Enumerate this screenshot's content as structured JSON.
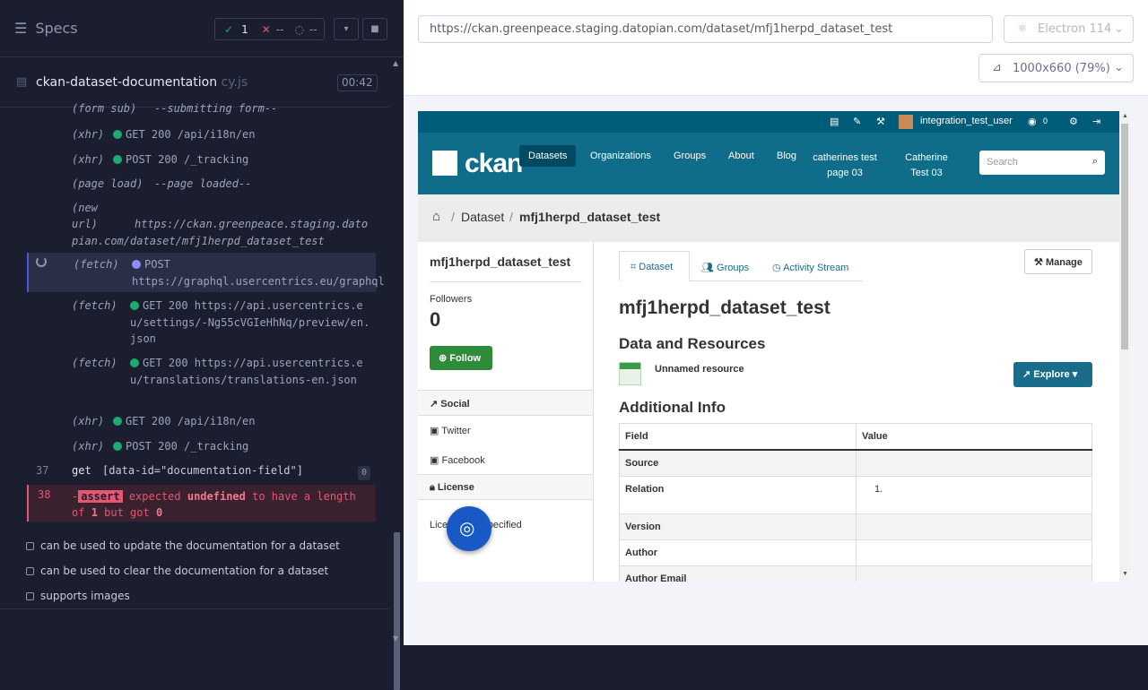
{
  "runner": {
    "specs_title": "Specs",
    "passed_count": "1",
    "failed_count": "--",
    "pending_count": "--",
    "file_name": "ckan-dataset-documentation",
    "file_ext": "cy.js",
    "timer": "00:42",
    "log": [
      {
        "label": "(form sub)",
        "text": "--submitting form--"
      },
      {
        "label": "(xhr)",
        "text": "GET 200 /api/i18n/en"
      },
      {
        "label": "(xhr)",
        "text": "POST 200 /_tracking"
      },
      {
        "label": "(page load)",
        "text": "--page loaded--"
      },
      {
        "label": "(new url)",
        "text": "https://ckan.greenpeace.staging.datopian.com/dataset/mfj1herpd_dataset_test"
      },
      {
        "label": "(fetch)",
        "text": "POST https://graphql.usercentrics.eu/graphql"
      },
      {
        "label": "(fetch)",
        "text": "GET 200 https://api.usercentrics.eu/settings/-Ng55cVGIeHhNq/preview/en.json"
      },
      {
        "label": "(fetch)",
        "text": "GET 200 https://api.usercentrics.eu/translations/translations-en.json"
      },
      {
        "label": "(xhr)",
        "text": "GET 200 /api/i18n/en"
      },
      {
        "label": "(xhr)",
        "text": "POST 200 /_tracking"
      }
    ],
    "cmd37": {
      "num": "37",
      "name": "get",
      "selector": "[data-id=\"documentation-field\"]",
      "count": "0"
    },
    "cmd38": {
      "num": "38",
      "dash": "-",
      "name": "assert",
      "t1": "expected",
      "t2": "undefined",
      "t3": "to have a length of",
      "t4": "1",
      "t5": "but got",
      "t6": "0"
    },
    "tests": [
      "can be used to update the documentation for a dataset",
      "can be used to clear the documentation for a dataset",
      "supports images"
    ]
  },
  "browser_bar": {
    "url": "https://ckan.greenpeace.staging.datopian.com/dataset/mfj1herpd_dataset_test",
    "browser": "Electron 114",
    "viewport": "1000x660 (79%)"
  },
  "ckan": {
    "username": "integration_test_user",
    "user_count": "0",
    "logo_text": "ckan",
    "nav": [
      "Datasets",
      "Organizations",
      "Groups",
      "About",
      "Blog",
      "catherines test page 03",
      "Catherine Test 03"
    ],
    "search_placeholder": "Search",
    "breadcrumb": [
      "Dataset",
      "mfj1herpd_dataset_test"
    ],
    "sidebar_title": "mfj1herpd_dataset_test",
    "followers_label": "Followers",
    "followers_count": "0",
    "follow_button": "Follow",
    "social_header": "Social",
    "twitter": "Twitter",
    "facebook": "Facebook",
    "license_header": "License",
    "license_text": "License not specified",
    "tabs": [
      "Dataset",
      "Groups",
      "Activity Stream"
    ],
    "manage_button": "Manage",
    "dataset_title": "mfj1herpd_dataset_test",
    "resources_heading": "Data and Resources",
    "resource_name": "Unnamed resource",
    "explore_button": "Explore",
    "additional_info": "Additional Info",
    "table_headers": [
      "Field",
      "Value"
    ],
    "table_rows": [
      [
        "Source",
        ""
      ],
      [
        "Relation",
        "1."
      ],
      [
        "Version",
        ""
      ],
      [
        "Author",
        ""
      ],
      [
        "Author Email",
        ""
      ]
    ]
  }
}
